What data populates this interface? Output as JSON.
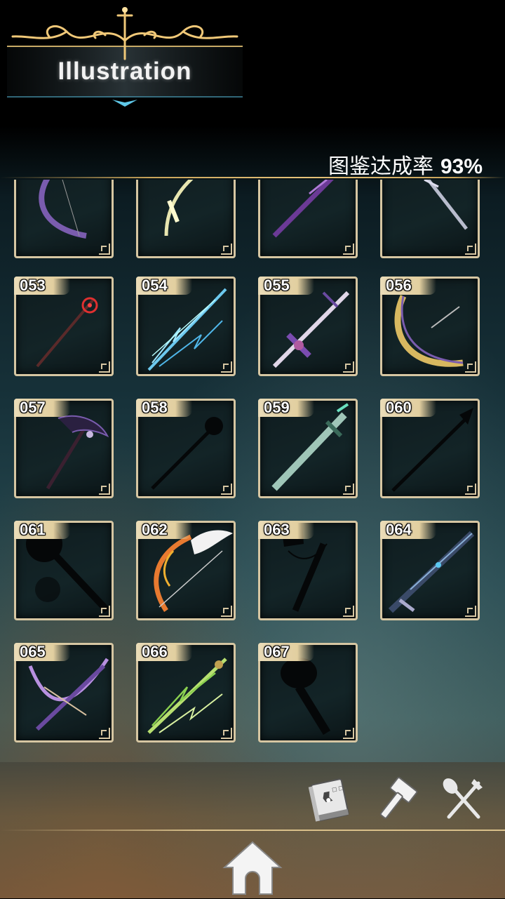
{
  "header": {
    "title": "Illustration",
    "completion_label": "图鉴达成率",
    "completion_value": "93%"
  },
  "items": [
    {
      "number": "",
      "weapon": "dark-purple-bow",
      "unlocked": true,
      "partial": true
    },
    {
      "number": "",
      "weapon": "light-bow",
      "unlocked": true,
      "partial": true
    },
    {
      "number": "",
      "weapon": "purple-lance",
      "unlocked": true,
      "partial": true
    },
    {
      "number": "",
      "weapon": "silver-lance",
      "unlocked": true,
      "partial": true
    },
    {
      "number": "053",
      "weapon": "red-staff",
      "unlocked": true
    },
    {
      "number": "054",
      "weapon": "lightning-spear",
      "unlocked": true
    },
    {
      "number": "055",
      "weapon": "violet-sword",
      "unlocked": true
    },
    {
      "number": "056",
      "weapon": "golden-crescent-bow",
      "unlocked": true
    },
    {
      "number": "057",
      "weapon": "dark-scythe",
      "unlocked": true
    },
    {
      "number": "058",
      "weapon": "staff-silhouette",
      "unlocked": false
    },
    {
      "number": "059",
      "weapon": "green-greatsword",
      "unlocked": true
    },
    {
      "number": "060",
      "weapon": "spear-silhouette",
      "unlocked": false
    },
    {
      "number": "061",
      "weapon": "mace-silhouette",
      "unlocked": false
    },
    {
      "number": "062",
      "weapon": "winged-flame-bow",
      "unlocked": true
    },
    {
      "number": "063",
      "weapon": "hammer-silhouette",
      "unlocked": false
    },
    {
      "number": "064",
      "weapon": "blue-katana",
      "unlocked": true
    },
    {
      "number": "065",
      "weapon": "purple-crossbow",
      "unlocked": true
    },
    {
      "number": "066",
      "weapon": "green-leaf-spear",
      "unlocked": true
    },
    {
      "number": "067",
      "weapon": "club-silhouette",
      "unlocked": false
    }
  ],
  "toolbar": {
    "book_icon": "book-icon",
    "hammer_icon": "hammer-icon",
    "cutlery_icon": "fork-knife-icon",
    "home_icon": "home-icon"
  },
  "colors": {
    "gold": "#e6c27a",
    "card_border": "#d6c6a2",
    "number_tab": "#e2cfa0"
  }
}
